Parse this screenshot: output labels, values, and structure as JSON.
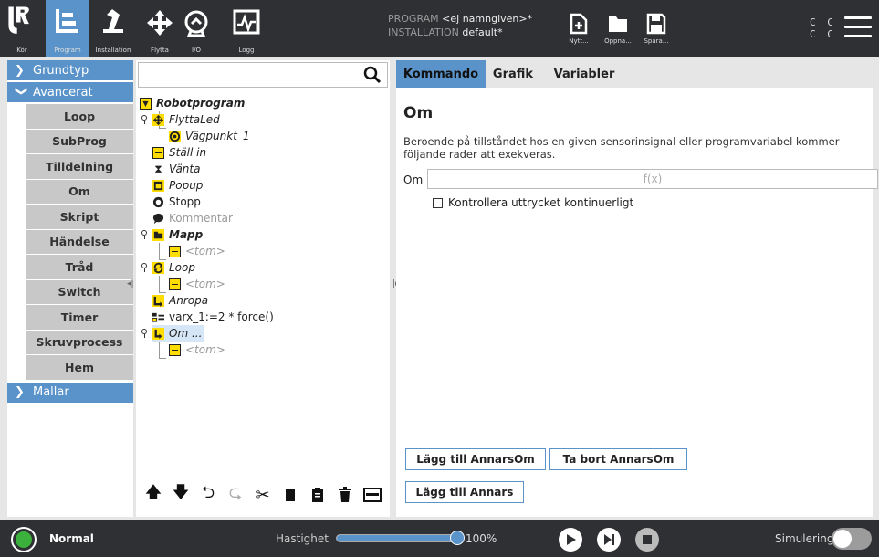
{
  "header": {
    "nav": [
      {
        "label": "Kör",
        "icon": "ur-logo-icon"
      },
      {
        "label": "Program",
        "icon": "program-icon",
        "active": true
      },
      {
        "label": "Installation",
        "icon": "installation-icon"
      },
      {
        "label": "Flytta",
        "icon": "move-icon"
      },
      {
        "label": "I/O",
        "icon": "io-icon"
      },
      {
        "label": "Logg",
        "icon": "log-icon"
      }
    ],
    "program_key": "PROGRAM",
    "program_value": "<ej namngiven>*",
    "installation_key": "INSTALLATION",
    "installation_value": "default*",
    "file_buttons": [
      {
        "label": "Nytt...",
        "icon": "new-file-icon"
      },
      {
        "label": "Öppna...",
        "icon": "open-folder-icon"
      },
      {
        "label": "Spara...",
        "icon": "save-icon"
      }
    ],
    "cc_top": "C C",
    "cc_bottom": "C C"
  },
  "left": {
    "categories": [
      "Grundtyp",
      "Avancerat",
      "Mallar"
    ],
    "items": [
      "Loop",
      "SubProg",
      "Tilldelning",
      "Om",
      "Skript",
      "Händelse",
      "Tråd",
      "Switch",
      "Timer",
      "Skruvprocess",
      "Hem"
    ]
  },
  "tree": {
    "search_placeholder": "",
    "nodes": [
      {
        "text": "Robotprogram"
      },
      {
        "text": "FlyttaLed"
      },
      {
        "text": "Vägpunkt_1"
      },
      {
        "text": "Ställ in"
      },
      {
        "text": "Vänta"
      },
      {
        "text": "Popup"
      },
      {
        "text": "Stopp"
      },
      {
        "text": "Kommentar"
      },
      {
        "text": "Mapp"
      },
      {
        "text": "<tom>"
      },
      {
        "text": "Loop"
      },
      {
        "text": "<tom>"
      },
      {
        "text": "Anropa"
      },
      {
        "text": "varx_1:=2 * force()"
      },
      {
        "text": "Om ..."
      },
      {
        "text": "<tom>"
      }
    ]
  },
  "right": {
    "tabs": [
      "Kommando",
      "Grafik",
      "Variabler"
    ],
    "title": "Om",
    "description": "Beroende på tillståndet hos en given sensorinsignal eller programvariabel kommer följande rader att exekveras.",
    "om_label": "Om",
    "expression_placeholder": "f(x)",
    "checkbox_label": "Kontrollera uttrycket kontinuerligt",
    "btn_add_elseif": "Lägg till AnnarsOm",
    "btn_remove_elseif": "Ta bort AnnarsOm",
    "btn_add_else": "Lägg till Annars"
  },
  "footer": {
    "status": "Normal",
    "speed_label": "Hastighet",
    "speed_value": "100%",
    "speed_fraction": 1.0,
    "sim_label": "Simulering"
  },
  "colors": {
    "accent": "#5a93c9",
    "header": "#2f3033",
    "highlight": "#ffdd00",
    "power_on": "#3bb03b"
  }
}
